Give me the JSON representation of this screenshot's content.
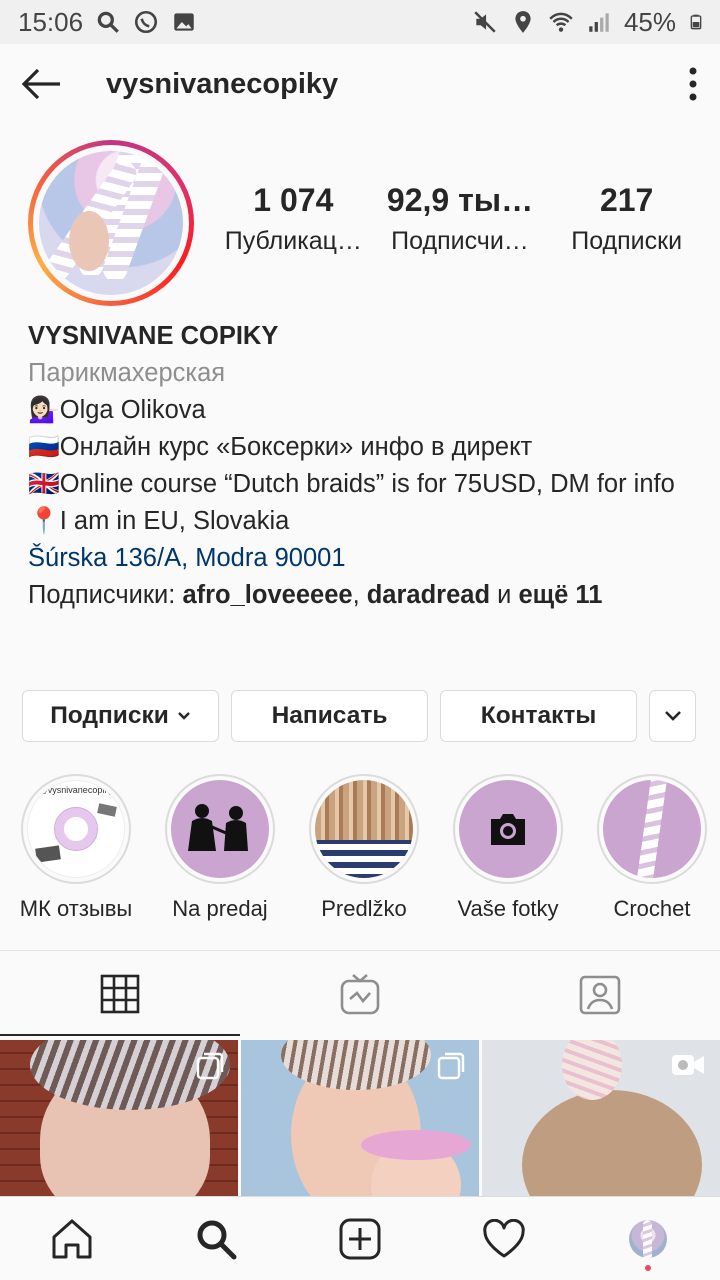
{
  "status_bar": {
    "time": "15:06",
    "battery": "45%"
  },
  "header": {
    "username": "vysnivanecopiky"
  },
  "profile": {
    "stats": [
      {
        "value": "1 074",
        "label": "Публикац…"
      },
      {
        "value": "92,9 ты…",
        "label": "Подписчи…"
      },
      {
        "value": "217",
        "label": "Подписки"
      }
    ],
    "name": "VYSNIVANE COPIKY",
    "category": "Парикмахерская",
    "bio_lines": [
      "💁🏻‍♀️Olga Olikova",
      "🇷🇺Онлайн курс «Боксерки» инфо в директ",
      "🇬🇧Online course “Dutch braids” is for 75USD, DM for info",
      "📍I am in EU, Slovakia"
    ],
    "address": "Šúrska 136/A, Modra 90001",
    "followers_prefix": "Подписчики: ",
    "follower_1": "afro_loveeeee",
    "followers_sep": ", ",
    "follower_2": "daradread",
    "followers_and": " и ",
    "followers_more": "ещё 11"
  },
  "actions": {
    "following": "Подписки",
    "message": "Написать",
    "contacts": "Контакты"
  },
  "highlights": [
    {
      "label": "МК отзывы"
    },
    {
      "label": "Na predaj"
    },
    {
      "label": "Predlžko"
    },
    {
      "label": "Vaše fotky"
    },
    {
      "label": "Crochet"
    }
  ],
  "highlight_1_text": {
    "handle": "@vysnivanecopiky"
  },
  "colors": {
    "link": "#00376b",
    "highlight_bg": "#c9a5cf",
    "notification_dot": "#ed4956"
  },
  "tabs": [
    {
      "icon": "grid-icon",
      "active": true
    },
    {
      "icon": "igtv-icon",
      "active": false
    },
    {
      "icon": "tagged-icon",
      "active": false
    }
  ],
  "bottom_nav": [
    {
      "icon": "home-icon"
    },
    {
      "icon": "search-icon"
    },
    {
      "icon": "new-post-icon"
    },
    {
      "icon": "heart-icon"
    },
    {
      "icon": "profile-avatar"
    }
  ]
}
